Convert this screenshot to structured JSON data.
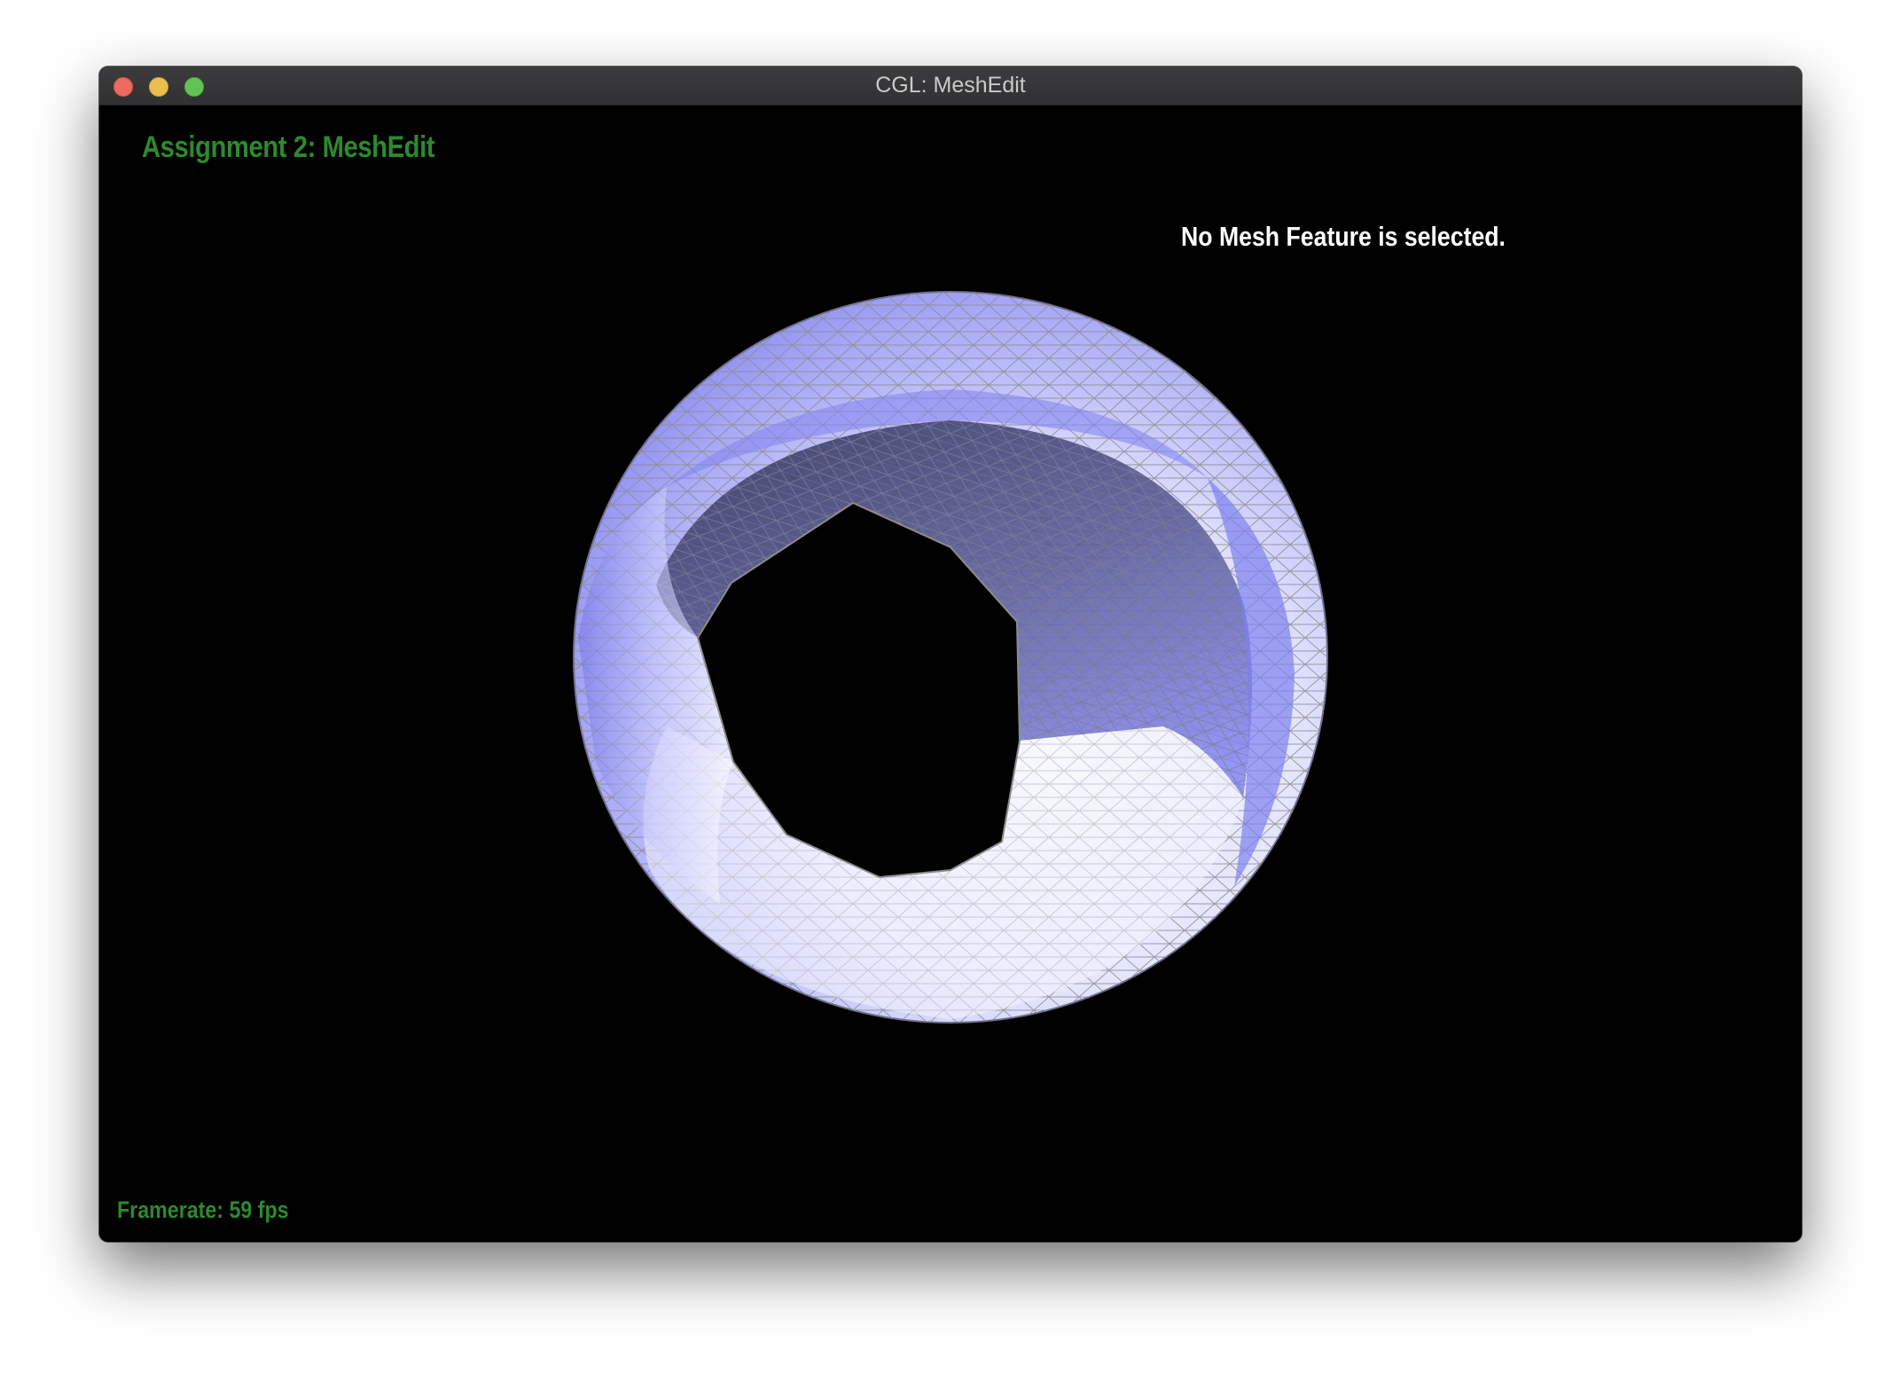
{
  "window": {
    "title": "CGL: MeshEdit",
    "buttons": [
      "close",
      "minimize",
      "zoom"
    ]
  },
  "overlay": {
    "heading": "Assignment 2: MeshEdit",
    "selection_status": "No Mesh Feature is selected.",
    "framerate": "Framerate: 59 fps"
  },
  "mesh": {
    "shape": "torus-with-hexagonal-hole",
    "render_mode": "shaded-wireframe",
    "surface_color": "#8a8cf2",
    "highlight_color": "#f4f4ff",
    "wire_color": "#8c8c8c"
  },
  "colors": {
    "background": "#000000",
    "heading_green": "#2c8a2c",
    "status_text": "#ffffff"
  }
}
